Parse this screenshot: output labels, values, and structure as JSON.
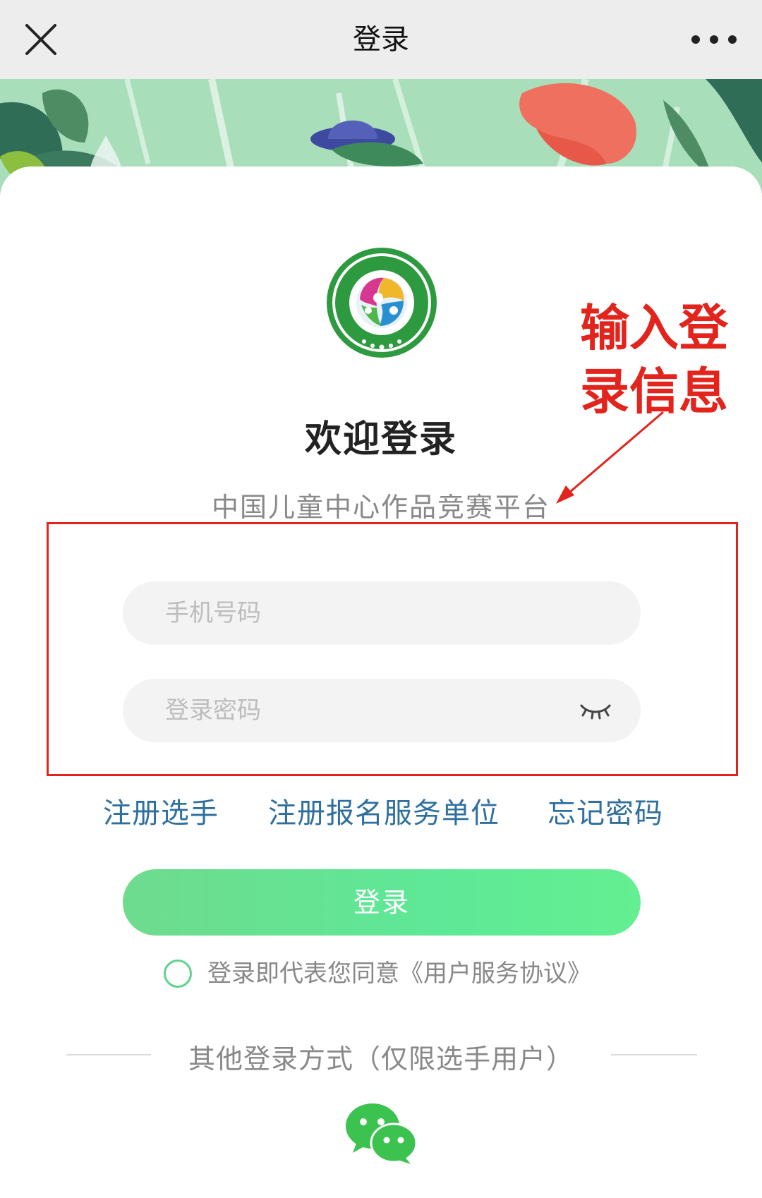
{
  "topbar": {
    "title": "登录",
    "close_icon": "close-icon",
    "more_icon": "more-icon"
  },
  "login": {
    "welcome": "欢迎登录",
    "subtitle": "中国儿童中心作品竞赛平台",
    "phone_placeholder": "手机号码",
    "password_placeholder": "登录密码",
    "login_button": "登录",
    "agreement": "登录即代表您同意《用户服务协议》",
    "other_login_title": "其他登录方式（仅限选手用户）"
  },
  "links": {
    "register_player": "注册选手",
    "register_unit": "注册报名服务单位",
    "forgot_password": "忘记密码"
  },
  "annotation": {
    "text": "输入登录信息",
    "color": "#e3241d"
  },
  "colors": {
    "accent_green": "#5ee897",
    "link_blue": "#2f6f9e",
    "highlight_red": "#e3241d",
    "wechat_green": "#3cc24e"
  },
  "icons": {
    "eye": "eye-closed-icon",
    "wechat": "wechat-icon",
    "logo": "competition-logo"
  }
}
